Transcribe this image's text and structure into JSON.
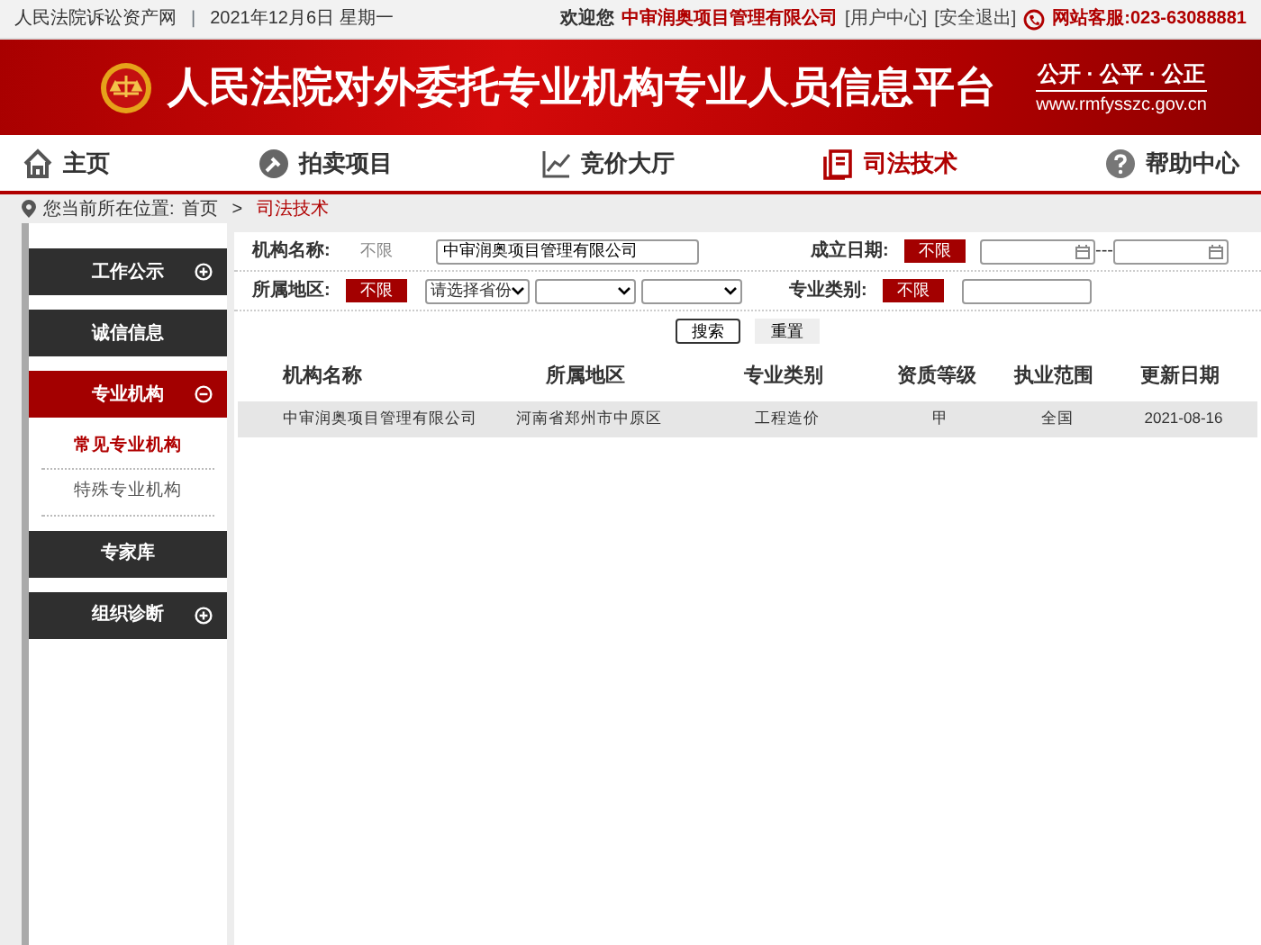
{
  "topbar": {
    "site_link": "人民法院诉讼资产网",
    "separator": "|",
    "date": "2021年12月6日  星期一",
    "welcome": "欢迎您",
    "user": "中审润奥项目管理有限公司",
    "links": [
      "[用户中心]",
      "[安全退出]"
    ],
    "hotline": "网站客服:023-63088881"
  },
  "banner": {
    "title": "人民法院对外委托专业机构专业人员信息平台",
    "slogan": "公开 · 公平 · 公正",
    "url": "www.rmfysszc.gov.cn"
  },
  "nav": [
    {
      "label": "主页",
      "selected": false
    },
    {
      "label": "拍卖项目",
      "selected": false
    },
    {
      "label": "竞价大厅",
      "selected": false
    },
    {
      "label": "司法技术",
      "selected": true
    },
    {
      "label": "帮助中心",
      "selected": false
    }
  ],
  "breadcrumb": {
    "prefix": "您当前所在位置:",
    "items": [
      "首页",
      "司法技术"
    ],
    "separator": ">"
  },
  "sidebar": [
    {
      "label": "工作公示",
      "kind": "folder",
      "expanded": false,
      "selected": false
    },
    {
      "label": "诚信信息",
      "kind": "link",
      "selected": false
    },
    {
      "label": "专业机构",
      "kind": "folder",
      "expanded": true,
      "selected": true,
      "children": [
        {
          "label": "常见专业机构",
          "selected": true
        },
        {
          "label": "特殊专业机构",
          "selected": false
        }
      ]
    },
    {
      "label": "专家库",
      "kind": "link",
      "selected": false
    },
    {
      "label": "组织诊断",
      "kind": "folder",
      "expanded": false,
      "selected": false
    }
  ],
  "filters": {
    "name": {
      "label": "机构名称:",
      "any": "不限",
      "any_active": false,
      "value": "中审润奥项目管理有限公司"
    },
    "founded": {
      "label": "成立日期:",
      "any": "不限",
      "any_active": true,
      "separator": "---"
    },
    "region": {
      "label": "所属地区:",
      "any": "不限",
      "any_active": true,
      "province": "请选择省份"
    },
    "category": {
      "label": "专业类别:",
      "any": "不限",
      "any_active": true
    }
  },
  "buttons": [
    {
      "label": "搜索",
      "kind": "primary"
    },
    {
      "label": "重置",
      "kind": "secondary"
    }
  ],
  "table": {
    "columns": [
      "机构名称",
      "所属地区",
      "专业类别",
      "资质等级",
      "执业范围",
      "更新日期"
    ],
    "rows": [
      [
        "中审润奥项目管理有限公司",
        "河南省郑州市中原区",
        "工程造价",
        "甲",
        "全国",
        "2021-08-16"
      ]
    ]
  }
}
